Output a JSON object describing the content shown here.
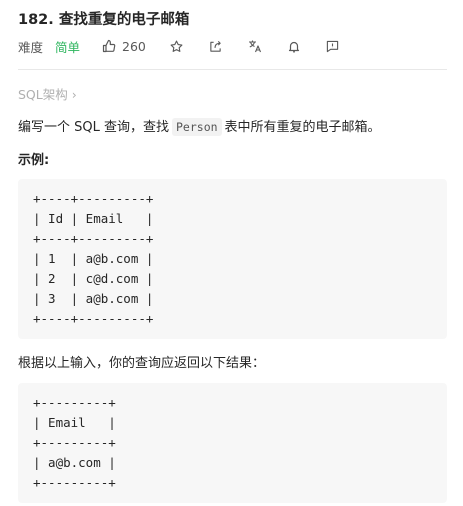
{
  "problem": {
    "title": "182. 查找重复的电子邮箱",
    "difficulty_label": "难度",
    "difficulty_value": "简单",
    "likes": "260"
  },
  "icons": {
    "like": "thumbs-up-icon",
    "star": "star-icon",
    "share": "share-icon",
    "translate": "translate-icon",
    "bell": "bell-icon",
    "feedback": "feedback-icon"
  },
  "breadcrumb": "SQL架构 ›",
  "description": {
    "before": "编写一个 SQL 查询，查找",
    "code": "Person",
    "after": "表中所有重复的电子邮箱。"
  },
  "example_label": "示例:",
  "input_table_lines": [
    "+----+---------+",
    "| Id | Email   |",
    "+----+---------+",
    "| 1  | a@b.com |",
    "| 2  | c@d.com |",
    "| 3  | a@b.com |",
    "+----+---------+"
  ],
  "result_text": "根据以上输入，你的查询应返回以下结果：",
  "output_table_lines": [
    "+---------+",
    "| Email   |",
    "+---------+",
    "| a@b.com |",
    "+---------+"
  ],
  "colors": {
    "easy": "#2db55d",
    "code_bg": "#f7f7f7",
    "muted": "#b0b0b0"
  }
}
